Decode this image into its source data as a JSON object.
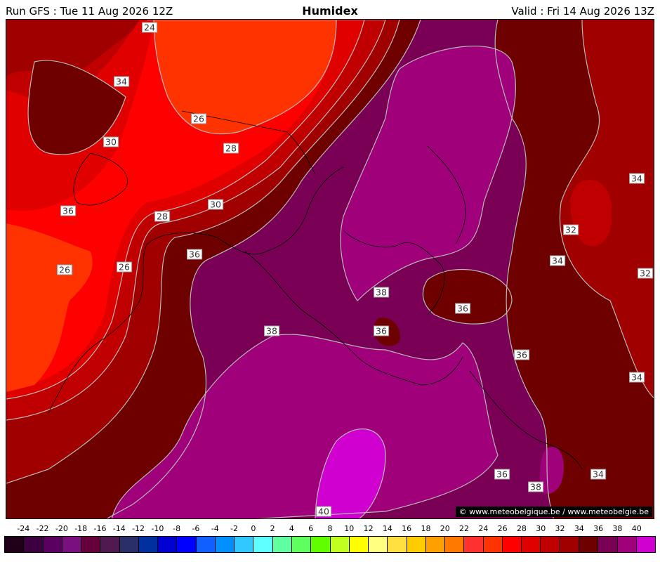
{
  "header": {
    "run": "Run GFS : Tue 11 Aug 2026 12Z",
    "title": "Humidex",
    "valid": "Valid : Fri 14 Aug 2026 13Z"
  },
  "map": {
    "contour_labels": [
      "24",
      "34",
      "26",
      "30",
      "28",
      "36",
      "30",
      "28",
      "26",
      "26",
      "36",
      "38",
      "36",
      "38",
      "36",
      "36",
      "34",
      "32",
      "34",
      "34",
      "32",
      "36",
      "34",
      "38",
      "40"
    ],
    "copyright": "© www.meteobelgique.be / www.meteobelgie.be"
  },
  "legend": {
    "ticks": [
      "-24",
      "-22",
      "-20",
      "-18",
      "-16",
      "-14",
      "-12",
      "-10",
      "-8",
      "-6",
      "-4",
      "-2",
      "0",
      "2",
      "4",
      "6",
      "8",
      "10",
      "12",
      "14",
      "16",
      "18",
      "20",
      "22",
      "24",
      "26",
      "28",
      "30",
      "32",
      "34",
      "36",
      "38",
      "40"
    ],
    "colors": [
      "#200018",
      "#3c0040",
      "#5a0060",
      "#7a1080",
      "#66003c",
      "#501a50",
      "#2a2f6a",
      "#0030a0",
      "#0000d0",
      "#0000ff",
      "#1060ff",
      "#0090ff",
      "#30c8ff",
      "#60ffff",
      "#60ffa0",
      "#60ff60",
      "#60ff00",
      "#c0ff20",
      "#ffff00",
      "#ffff80",
      "#ffe040",
      "#ffcc00",
      "#ffa000",
      "#ff7800",
      "#ff3030",
      "#ff3300",
      "#ff0000",
      "#e00000",
      "#c00000",
      "#a00000",
      "#6e0000",
      "#7a0055",
      "#a0007a",
      "#d000d0"
    ]
  }
}
